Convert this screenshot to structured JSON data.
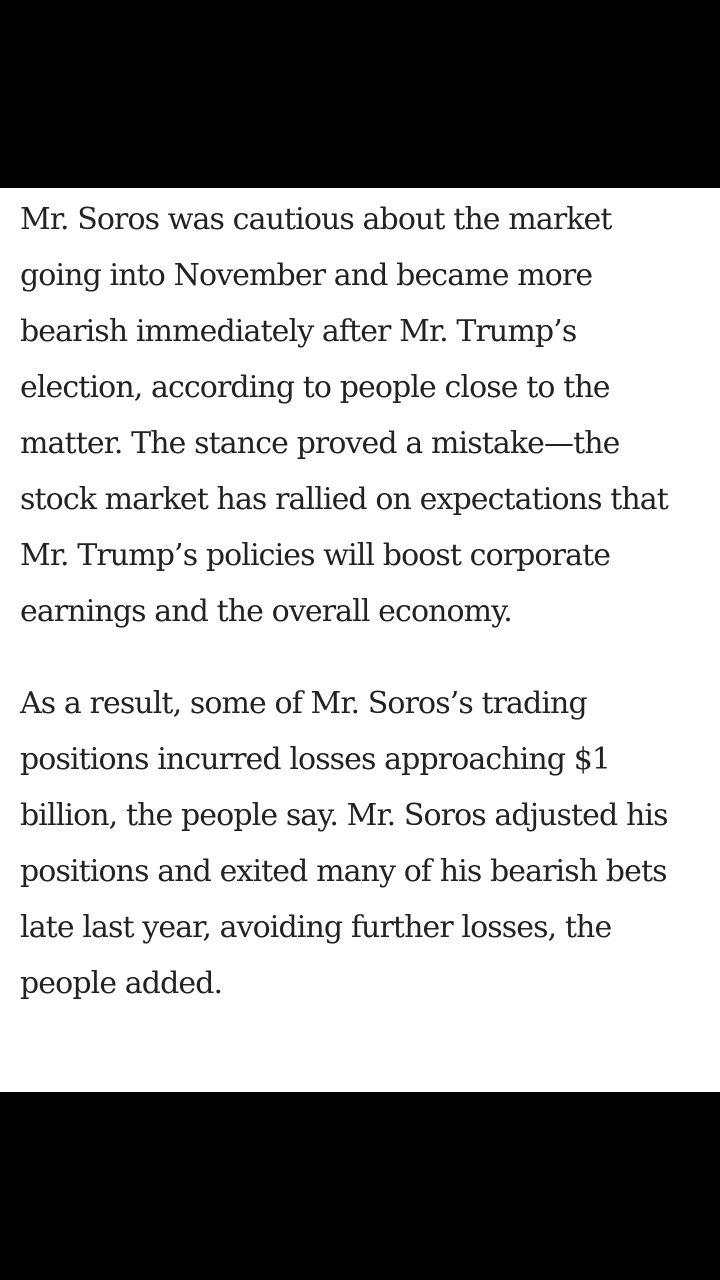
{
  "article": {
    "paragraphs": [
      "Mr. Soros was cautious about the market going into November and became more bearish immediately after Mr. Trump’s election, according to people close to the matter. The stance proved a mistake—the stock market has rallied on expectations that Mr. Trump’s policies will boost corporate earnings and the overall economy.",
      "As a result, some of Mr. Soros’s trading positions incurred losses approaching $1 billion, the people say. Mr. Soros adjusted his positions and exited many of his bearish bets late last year, avoiding further losses, the people added."
    ]
  },
  "colors": {
    "background": "#000000",
    "article_background": "#ffffff",
    "text": "#222222"
  }
}
